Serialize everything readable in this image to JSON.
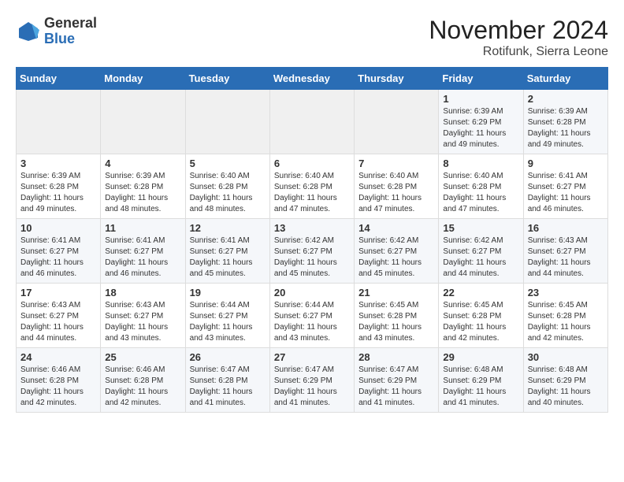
{
  "logo": {
    "general": "General",
    "blue": "Blue"
  },
  "title": "November 2024",
  "location": "Rotifunk, Sierra Leone",
  "days_of_week": [
    "Sunday",
    "Monday",
    "Tuesday",
    "Wednesday",
    "Thursday",
    "Friday",
    "Saturday"
  ],
  "weeks": [
    [
      {
        "day": "",
        "info": ""
      },
      {
        "day": "",
        "info": ""
      },
      {
        "day": "",
        "info": ""
      },
      {
        "day": "",
        "info": ""
      },
      {
        "day": "",
        "info": ""
      },
      {
        "day": "1",
        "info": "Sunrise: 6:39 AM\nSunset: 6:29 PM\nDaylight: 11 hours and 49 minutes."
      },
      {
        "day": "2",
        "info": "Sunrise: 6:39 AM\nSunset: 6:28 PM\nDaylight: 11 hours and 49 minutes."
      }
    ],
    [
      {
        "day": "3",
        "info": "Sunrise: 6:39 AM\nSunset: 6:28 PM\nDaylight: 11 hours and 49 minutes."
      },
      {
        "day": "4",
        "info": "Sunrise: 6:39 AM\nSunset: 6:28 PM\nDaylight: 11 hours and 48 minutes."
      },
      {
        "day": "5",
        "info": "Sunrise: 6:40 AM\nSunset: 6:28 PM\nDaylight: 11 hours and 48 minutes."
      },
      {
        "day": "6",
        "info": "Sunrise: 6:40 AM\nSunset: 6:28 PM\nDaylight: 11 hours and 47 minutes."
      },
      {
        "day": "7",
        "info": "Sunrise: 6:40 AM\nSunset: 6:28 PM\nDaylight: 11 hours and 47 minutes."
      },
      {
        "day": "8",
        "info": "Sunrise: 6:40 AM\nSunset: 6:28 PM\nDaylight: 11 hours and 47 minutes."
      },
      {
        "day": "9",
        "info": "Sunrise: 6:41 AM\nSunset: 6:27 PM\nDaylight: 11 hours and 46 minutes."
      }
    ],
    [
      {
        "day": "10",
        "info": "Sunrise: 6:41 AM\nSunset: 6:27 PM\nDaylight: 11 hours and 46 minutes."
      },
      {
        "day": "11",
        "info": "Sunrise: 6:41 AM\nSunset: 6:27 PM\nDaylight: 11 hours and 46 minutes."
      },
      {
        "day": "12",
        "info": "Sunrise: 6:41 AM\nSunset: 6:27 PM\nDaylight: 11 hours and 45 minutes."
      },
      {
        "day": "13",
        "info": "Sunrise: 6:42 AM\nSunset: 6:27 PM\nDaylight: 11 hours and 45 minutes."
      },
      {
        "day": "14",
        "info": "Sunrise: 6:42 AM\nSunset: 6:27 PM\nDaylight: 11 hours and 45 minutes."
      },
      {
        "day": "15",
        "info": "Sunrise: 6:42 AM\nSunset: 6:27 PM\nDaylight: 11 hours and 44 minutes."
      },
      {
        "day": "16",
        "info": "Sunrise: 6:43 AM\nSunset: 6:27 PM\nDaylight: 11 hours and 44 minutes."
      }
    ],
    [
      {
        "day": "17",
        "info": "Sunrise: 6:43 AM\nSunset: 6:27 PM\nDaylight: 11 hours and 44 minutes."
      },
      {
        "day": "18",
        "info": "Sunrise: 6:43 AM\nSunset: 6:27 PM\nDaylight: 11 hours and 43 minutes."
      },
      {
        "day": "19",
        "info": "Sunrise: 6:44 AM\nSunset: 6:27 PM\nDaylight: 11 hours and 43 minutes."
      },
      {
        "day": "20",
        "info": "Sunrise: 6:44 AM\nSunset: 6:27 PM\nDaylight: 11 hours and 43 minutes."
      },
      {
        "day": "21",
        "info": "Sunrise: 6:45 AM\nSunset: 6:28 PM\nDaylight: 11 hours and 43 minutes."
      },
      {
        "day": "22",
        "info": "Sunrise: 6:45 AM\nSunset: 6:28 PM\nDaylight: 11 hours and 42 minutes."
      },
      {
        "day": "23",
        "info": "Sunrise: 6:45 AM\nSunset: 6:28 PM\nDaylight: 11 hours and 42 minutes."
      }
    ],
    [
      {
        "day": "24",
        "info": "Sunrise: 6:46 AM\nSunset: 6:28 PM\nDaylight: 11 hours and 42 minutes."
      },
      {
        "day": "25",
        "info": "Sunrise: 6:46 AM\nSunset: 6:28 PM\nDaylight: 11 hours and 42 minutes."
      },
      {
        "day": "26",
        "info": "Sunrise: 6:47 AM\nSunset: 6:28 PM\nDaylight: 11 hours and 41 minutes."
      },
      {
        "day": "27",
        "info": "Sunrise: 6:47 AM\nSunset: 6:29 PM\nDaylight: 11 hours and 41 minutes."
      },
      {
        "day": "28",
        "info": "Sunrise: 6:47 AM\nSunset: 6:29 PM\nDaylight: 11 hours and 41 minutes."
      },
      {
        "day": "29",
        "info": "Sunrise: 6:48 AM\nSunset: 6:29 PM\nDaylight: 11 hours and 41 minutes."
      },
      {
        "day": "30",
        "info": "Sunrise: 6:48 AM\nSunset: 6:29 PM\nDaylight: 11 hours and 40 minutes."
      }
    ]
  ]
}
